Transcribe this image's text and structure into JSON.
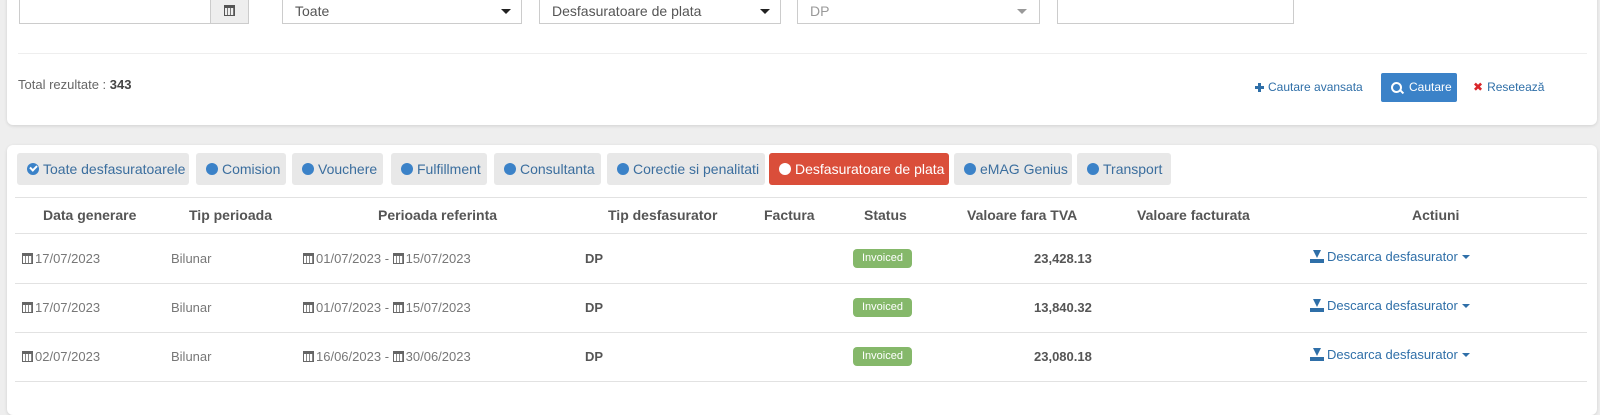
{
  "filters": {
    "date_value": "",
    "period_select": "Toate",
    "type_select": "Desfasuratoare de plata",
    "sub_type_select": "DP",
    "extra_value": ""
  },
  "results": {
    "label": "Total rezultate : ",
    "count": "343"
  },
  "actions": {
    "advanced_search": "Cautare avansata",
    "search": "Cautare",
    "reset": "Resetează"
  },
  "tabs": [
    {
      "label": "Toate desfasuratoarele",
      "icon": "check-circle-icon"
    },
    {
      "label": "Comision",
      "icon": "circle-icon"
    },
    {
      "label": "Vouchere",
      "icon": "circle-icon"
    },
    {
      "label": "Fulfillment",
      "icon": "circle-icon"
    },
    {
      "label": "Consultanta",
      "icon": "circle-icon"
    },
    {
      "label": "Corectie si penalitati",
      "icon": "circle-icon"
    },
    {
      "label": "Desfasuratoare de plata",
      "icon": "circle-icon",
      "active": true
    },
    {
      "label": "eMAG Genius",
      "icon": "circle-icon"
    },
    {
      "label": "Transport",
      "icon": "circle-icon"
    }
  ],
  "table": {
    "headers": [
      "Data generare",
      "Tip perioada",
      "Perioada referinta",
      "Tip desfasurator",
      "Factura",
      "Status",
      "Valoare fara TVA",
      "Valoare facturata",
      "Actiuni"
    ],
    "rows": [
      {
        "date": "17/07/2023",
        "period_type": "Bilunar",
        "from": "01/07/2023",
        "to": "15/07/2023",
        "type": "DP",
        "invoice": "",
        "status": "Invoiced",
        "value": "23,428.13",
        "billed": "",
        "action": "Descarca desfasurator"
      },
      {
        "date": "17/07/2023",
        "period_type": "Bilunar",
        "from": "01/07/2023",
        "to": "15/07/2023",
        "type": "DP",
        "invoice": "",
        "status": "Invoiced",
        "value": "13,840.32",
        "billed": "",
        "action": "Descarca desfasurator"
      },
      {
        "date": "02/07/2023",
        "period_type": "Bilunar",
        "from": "16/06/2023",
        "to": "30/06/2023",
        "type": "DP",
        "invoice": "",
        "status": "Invoiced",
        "value": "23,080.18",
        "billed": "",
        "action": "Descarca desfasurator"
      }
    ]
  },
  "colors": {
    "primary": "#3b82c8",
    "active_tab": "#da4e3a",
    "status_invoiced": "#85b86a",
    "reset": "#d9262a"
  }
}
